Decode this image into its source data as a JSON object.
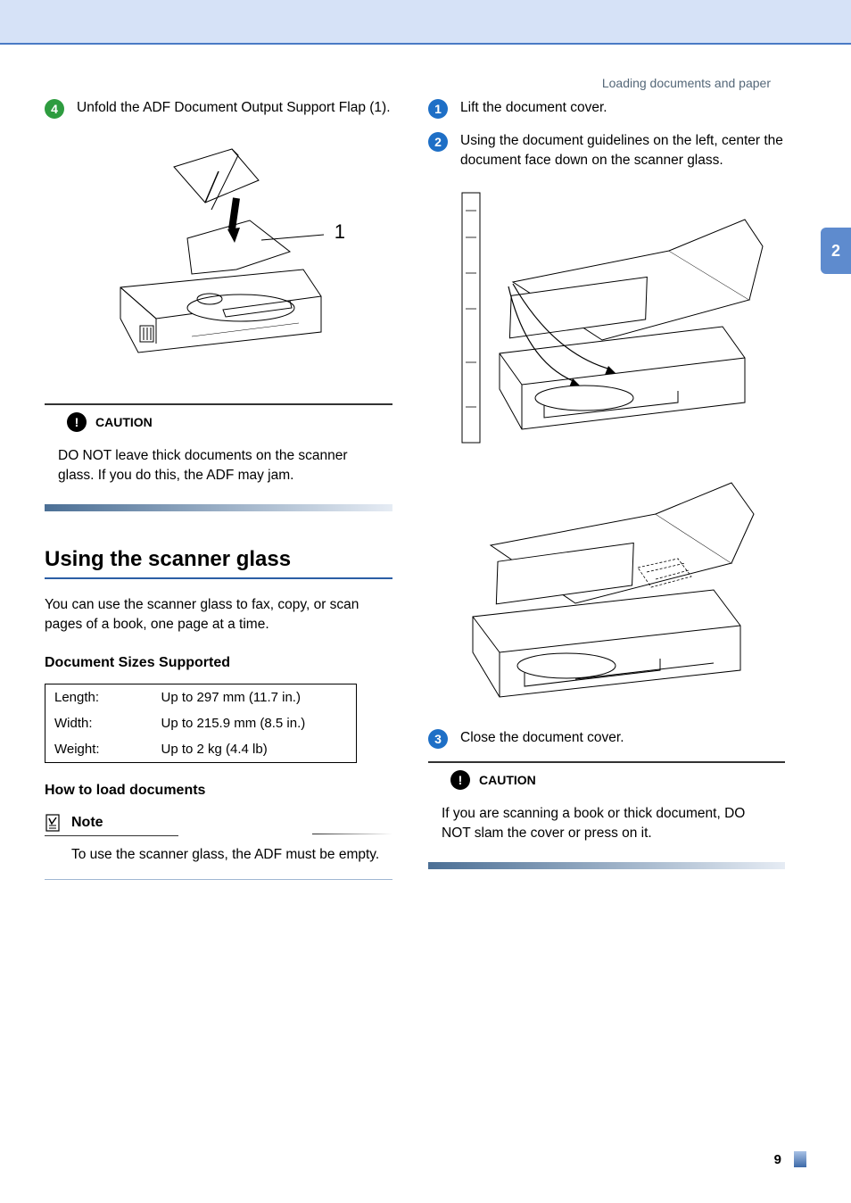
{
  "breadcrumb": "Loading documents and paper",
  "chapter_tab": "2",
  "page_number": "9",
  "left_col": {
    "step4": {
      "num": "4",
      "text": "Unfold the ADF Document Output Support Flap (1)."
    },
    "figure_callout": "1",
    "caution": {
      "label": "CAUTION",
      "text": "DO NOT leave thick documents on the scanner glass. If you do this, the ADF may jam."
    },
    "section_title": "Using the scanner glass",
    "section_intro": "You can use the scanner glass to fax, copy, or scan pages of a book, one page at a time.",
    "sizes_heading": "Document Sizes Supported",
    "table": {
      "length_label": "Length:",
      "length_value": "Up to 297 mm (11.7 in.)",
      "width_label": "Width:",
      "width_value": "Up to 215.9 mm (8.5 in.)",
      "weight_label": "Weight:",
      "weight_value": "Up to 2 kg (4.4 lb)"
    },
    "how_to_heading": "How to load documents",
    "note": {
      "label": "Note",
      "text": "To use the scanner glass, the ADF must be empty."
    }
  },
  "right_col": {
    "step1": {
      "num": "1",
      "text": "Lift the document cover."
    },
    "step2": {
      "num": "2",
      "text": "Using the document guidelines on the left, center the document face down on the scanner glass."
    },
    "step3": {
      "num": "3",
      "text": "Close the document cover."
    },
    "caution": {
      "label": "CAUTION",
      "text": "If you are scanning a book or thick document, DO NOT slam the cover or press on it."
    }
  }
}
